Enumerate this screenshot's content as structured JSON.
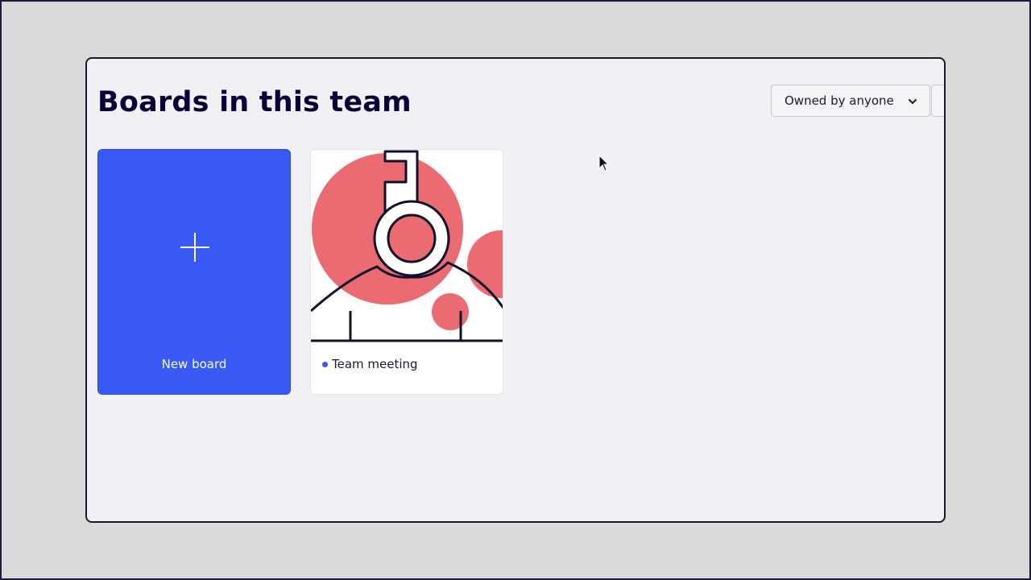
{
  "page": {
    "title": "Boards in this team"
  },
  "filter": {
    "selected": "Owned by anyone",
    "icon": "chevron-down-icon"
  },
  "new_board": {
    "label": "New board",
    "icon": "plus-icon",
    "color": "#3859f5"
  },
  "boards": [
    {
      "name": "Team meeting",
      "dot_color": "#3859f5",
      "thumbnail": "key-illustration"
    }
  ],
  "colors": {
    "accent": "#3859f5",
    "illustration_red": "#ea6b72",
    "title": "#050038"
  }
}
